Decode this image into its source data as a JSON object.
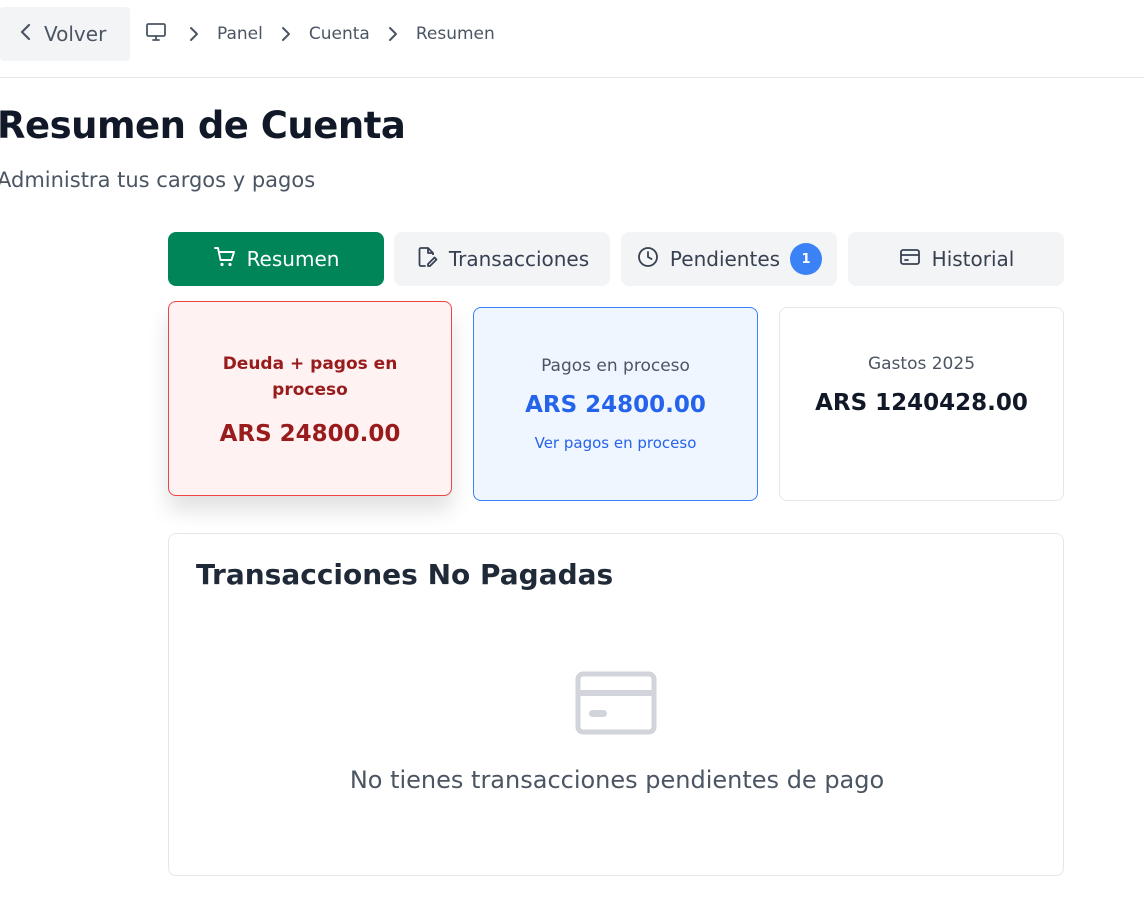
{
  "topbar": {
    "back_label": "Volver",
    "breadcrumb": [
      "Panel",
      "Cuenta",
      "Resumen"
    ]
  },
  "header": {
    "title": "Resumen de Cuenta",
    "subtitle": "Administra tus cargos y pagos"
  },
  "tabs": [
    {
      "label": "Resumen",
      "icon": "cart-icon",
      "active": true
    },
    {
      "label": "Transacciones",
      "icon": "edit-document-icon"
    },
    {
      "label": "Pendientes",
      "icon": "clock-icon",
      "badge": "1"
    },
    {
      "label": "Historial",
      "icon": "credit-card-icon"
    }
  ],
  "cards": {
    "debt": {
      "label": "Deuda + pagos en proceso",
      "amount": "ARS 24800.00"
    },
    "processing": {
      "label": "Pagos en proceso",
      "amount": "ARS 24800.00",
      "link": "Ver pagos en proceso"
    },
    "expenses": {
      "label": "Gastos 2025",
      "amount": "ARS 1240428.00"
    }
  },
  "unpaid": {
    "title": "Transacciones No Pagadas",
    "empty_icon": "credit-card-icon",
    "empty_message": "No tienes transacciones pendientes de pago"
  },
  "colors": {
    "accent": "#008558",
    "debt_red": "#991b1b",
    "processing_blue": "#2563eb",
    "badge_blue": "#3b82f6"
  }
}
